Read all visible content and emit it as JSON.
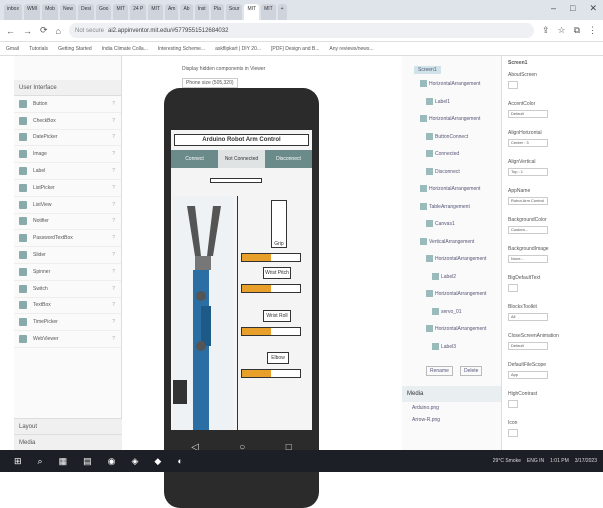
{
  "browser": {
    "tabs": [
      "inbox",
      "WMI",
      "Mob",
      "New",
      "Desi",
      "Goo",
      "MIT",
      "24 P",
      "MIT",
      "Am",
      "Ab",
      "Inst",
      "Pla",
      "Sour",
      "MIT",
      "MIT",
      "+"
    ],
    "active_tab_index": 14,
    "url": "ai2.appinventor.mit.edu/#5779551512684032",
    "url_prefix": "Not secure",
    "bookmarks": [
      "Gmail",
      "Tutorials",
      "Getting Started",
      "India Climate Colla...",
      "Interesting Scheme...",
      "askflipkart | DIY 20...",
      "[PDF] Design and B...",
      "Any reviews/news..."
    ]
  },
  "palette": {
    "header": "User Interface",
    "items": [
      "Button",
      "CheckBox",
      "DatePicker",
      "Image",
      "Label",
      "ListPicker",
      "ListView",
      "Notifier",
      "PasswordTextBox",
      "Slider",
      "Spinner",
      "Switch",
      "TextBox",
      "TimePicker",
      "WebViewer"
    ],
    "footer1": "Layout",
    "footer2": "Media"
  },
  "viewer": {
    "checkbox_text": "Display hidden components in Viewer",
    "phone_size": "Phone size (505,320)"
  },
  "app": {
    "title": "Arduino Robot Arm Control",
    "connect": "Connect",
    "status": "Not Connected",
    "disconnect": "Disconnect",
    "grip_label": "Grip",
    "wrist_pitch_label": "Wrist Pitch",
    "wrist_roll_label": "Wrist Roll",
    "elbow_label": "Elbow"
  },
  "sliders": {
    "grip": 0.5,
    "wrist_pitch": 0.5,
    "wrist_roll": 0.5,
    "elbow": 0.5
  },
  "components": {
    "screen": "Screen1",
    "items": [
      "HorizontalArrangement",
      "Label1",
      "HorizontalArrangement",
      "ButtonConnect",
      "Connected",
      "Disconnect",
      "HorizontalArrangement",
      "TableArrangement",
      "Canvas1",
      "VerticalArrangement",
      "HorizontalArrangement",
      "Label2",
      "HorizontalArrangement",
      "servo_01",
      "HorizontalArrangement",
      "Label3"
    ],
    "rename": "Rename",
    "delete": "Delete"
  },
  "media": {
    "header": "Media",
    "items": [
      "Arduino.png",
      "Arrow-R.png"
    ]
  },
  "properties": {
    "header": "Screen1",
    "rows": [
      {
        "name": "AboutScreen",
        "value": ""
      },
      {
        "name": "AccentColor",
        "value": "Default"
      },
      {
        "name": "AlignHorizontal",
        "value": "Center : 3"
      },
      {
        "name": "AlignVertical",
        "value": "Top : 1"
      },
      {
        "name": "AppName",
        "value": "Robot Arm Control"
      },
      {
        "name": "BackgroundColor",
        "value": "Custom..."
      },
      {
        "name": "BackgroundImage",
        "value": "None..."
      },
      {
        "name": "BigDefaultText",
        "value": ""
      },
      {
        "name": "BlocksToolkit",
        "value": "All"
      },
      {
        "name": "CloseScreenAnimation",
        "value": "Default"
      },
      {
        "name": "DefaultFileScope",
        "value": "App"
      },
      {
        "name": "HighContrast",
        "value": ""
      },
      {
        "name": "Icon",
        "value": ""
      }
    ]
  },
  "taskbar": {
    "weather": "29°C Smoke",
    "time": "1:01 PM",
    "date": "3/17/2023",
    "lang": "ENG IN"
  },
  "colors": {
    "slider_fill": "#e9a02a",
    "button_bg": "#6b8b8b",
    "taskbar_bg": "#1c1f26",
    "arm_blue": "#2b6ea3"
  }
}
